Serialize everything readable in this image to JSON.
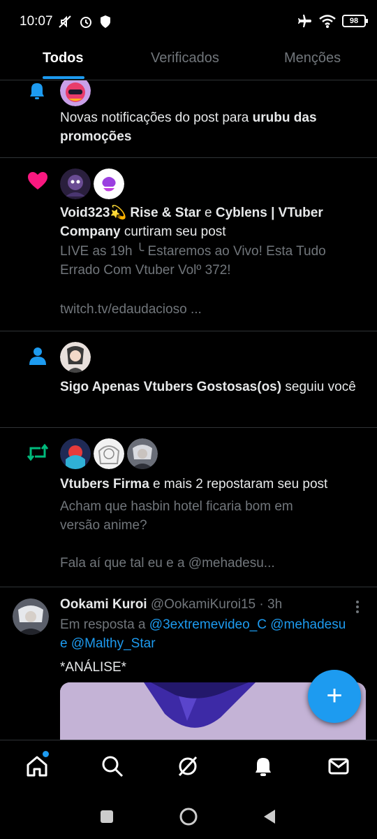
{
  "status_bar": {
    "time": "10:07",
    "battery": "98"
  },
  "tabs": [
    {
      "label": "Todos"
    },
    {
      "label": "Verificados"
    },
    {
      "label": "Menções"
    }
  ],
  "notifications": {
    "n1": {
      "text_pre": "Novas notificações do post para ",
      "bold": "urubu das promoções"
    },
    "n2": {
      "name1": "Void323💫 Rise & Star",
      "join": " e ",
      "name2": "Cyblens | VTuber Company",
      "action": " curtiram seu post",
      "preview_line1": "LIVE as 19h ╰ Estaremos ao Vivo! Esta Tudo",
      "preview_line2": "Errado Com Vtuber Volº 372!",
      "preview_line3": "twitch.tv/edaudacioso ..."
    },
    "n3": {
      "name": "Sigo Apenas Vtubers Gostosas(os)",
      "action": " seguiu você"
    },
    "n4": {
      "name": "Vtubers Firma",
      "action": " e mais 2 repostaram seu post",
      "preview_line1": "Acham que hasbin hotel ficaria bom em",
      "preview_line2": "versão anime?",
      "preview_line3": "Fala aí que tal eu e a @mehadesu..."
    }
  },
  "tweet": {
    "author": "Ookami Kuroi",
    "handle": "@OokamiKuroi15",
    "time": "· 3h",
    "reply_prefix": "Em resposta a ",
    "mention1": "@3extremevideo_C",
    "mention2": "@mehadesu",
    "reply_and": "e ",
    "mention3": "@Malthy_Star",
    "body": "*ANÁLISE*"
  },
  "fab": {
    "label": "+"
  },
  "colors": {
    "accent": "#1d9bf0",
    "like": "#f91880",
    "repost": "#00ba7c",
    "muted": "#71767b"
  },
  "icons": [
    "home-icon",
    "search-icon",
    "grok-icon",
    "notifications-icon",
    "messages-icon",
    "bell-icon",
    "heart-icon",
    "person-icon",
    "repost-icon",
    "more-icon"
  ]
}
